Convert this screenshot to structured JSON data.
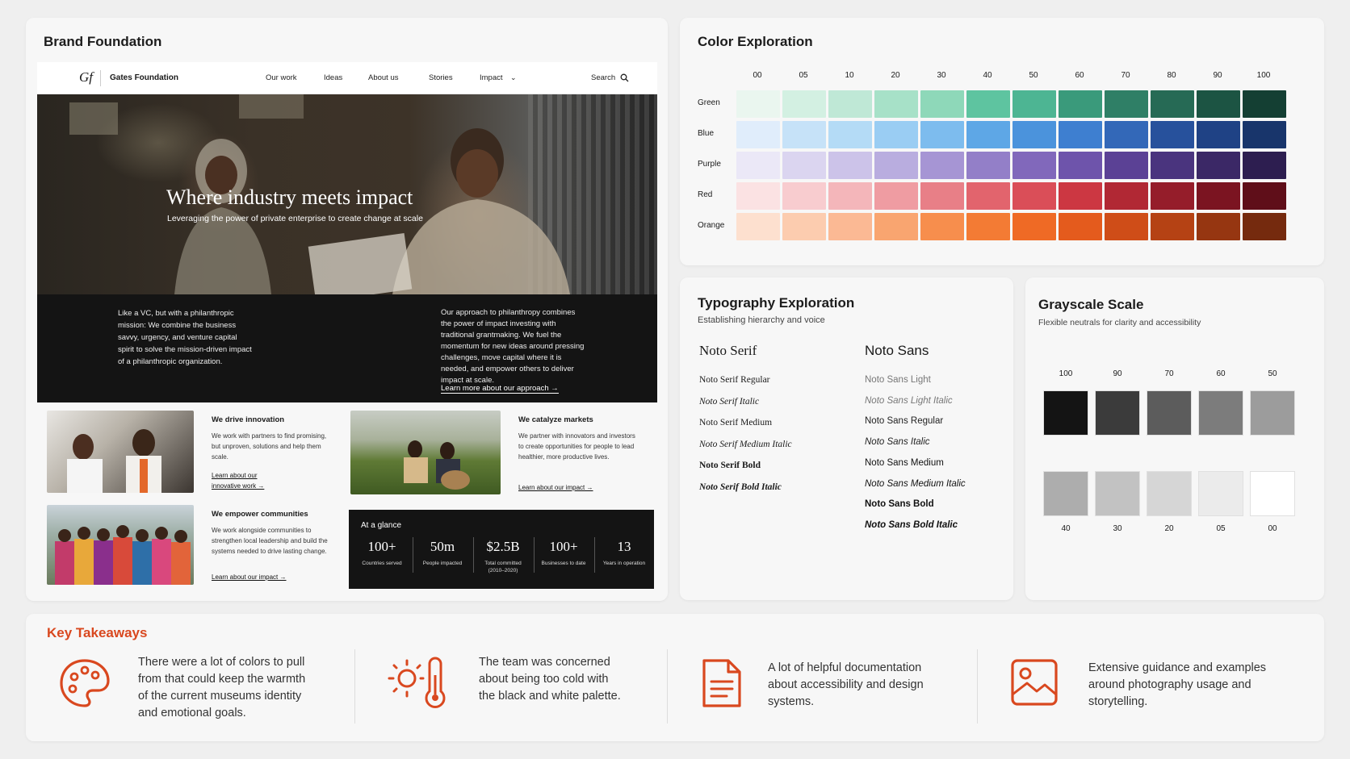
{
  "brand": {
    "title": "Brand Foundation",
    "site": {
      "logo_mark": "Gf",
      "logo_text": "Gates Foundation",
      "nav": [
        "Our work",
        "Ideas",
        "About us",
        "Stories",
        "Impact"
      ],
      "search": "Search",
      "hero_title": "Where industry meets impact",
      "hero_subtitle": "Leveraging the power of private enterprise to create change at scale",
      "intro_left": "Like a VC, but with a philanthropic mission: We combine the business savvy, urgency, and venture capital spirit to solve the mission-driven impact of a philanthropic organization.",
      "intro_right": "Our approach to philanthropy combines the power of impact investing with traditional grantmaking. We fuel the momentum for new ideas around pressing challenges, move capital where it is needed, and empower others to deliver impact at scale.",
      "intro_link": "Learn more about our approach →"
    },
    "features": [
      {
        "title": "We drive innovation",
        "body": "We work with partners to find promising, but unproven, solutions and help them scale.",
        "link": "Learn about our innovative work →"
      },
      {
        "title": "We catalyze markets",
        "body": "We partner with innovators and investors to create opportunities for people to lead healthier, more productive lives.",
        "link": "Learn about our impact →"
      },
      {
        "title": "We empower communities",
        "body": "We work alongside communities to strengthen local leadership and build the systems needed to drive lasting change.",
        "link": "Learn about our impact →"
      }
    ],
    "glance": {
      "title": "At a glance",
      "stats": [
        {
          "value": "100+",
          "label": "Countries served"
        },
        {
          "value": "50m",
          "label": "People impacted"
        },
        {
          "value": "$2.5B",
          "label": "Total committed (2010–2020)"
        },
        {
          "value": "100+",
          "label": "Businesses to date"
        },
        {
          "value": "13",
          "label": "Years in operation"
        }
      ]
    }
  },
  "color_exploration": {
    "title": "Color Exploration",
    "columns": [
      "00",
      "05",
      "10",
      "20",
      "30",
      "40",
      "50",
      "60",
      "70",
      "80",
      "90",
      "100"
    ],
    "rows": [
      {
        "name": "Green",
        "swatches": [
          "#eaf6ef",
          "#d3f0e2",
          "#bfe8d6",
          "#a7e1c8",
          "#8ed8b9",
          "#5ec4a0",
          "#4db593",
          "#3a9a7b",
          "#2f7f66",
          "#266a55",
          "#1c5443",
          "#143f33"
        ]
      },
      {
        "name": "Blue",
        "swatches": [
          "#e0edfb",
          "#c6e2f8",
          "#b4dbf6",
          "#9acdf3",
          "#7dbcee",
          "#5ea7e6",
          "#4b93dc",
          "#3e7fd0",
          "#3368b8",
          "#27519c",
          "#1f4285",
          "#18356b"
        ]
      },
      {
        "name": "Purple",
        "swatches": [
          "#ebe8f7",
          "#dbd5f0",
          "#ccc3e9",
          "#b9addf",
          "#a695d4",
          "#937fc8",
          "#8168bb",
          "#6e54ab",
          "#5b4195",
          "#4a347e",
          "#3b2866",
          "#2d1e50"
        ]
      },
      {
        "name": "Red",
        "swatches": [
          "#fbe2e3",
          "#f8cccf",
          "#f4b6ba",
          "#ef9ca2",
          "#e87f87",
          "#e2646d",
          "#da4e58",
          "#cc3742",
          "#b12834",
          "#951d2a",
          "#7b1421",
          "#5f0e19"
        ]
      },
      {
        "name": "Orange",
        "swatches": [
          "#fde0cf",
          "#fcccaf",
          "#fbb994",
          "#f9a570",
          "#f78e4d",
          "#f37b34",
          "#ef6a25",
          "#e45b1d",
          "#cf4d18",
          "#b54214",
          "#963611",
          "#752a0e"
        ]
      }
    ]
  },
  "typography": {
    "title": "Typography Exploration",
    "subtitle": "Establishing hierarchy and voice",
    "serif_heading": "Noto Serif",
    "sans_heading": "Noto Sans",
    "serif": [
      "Noto Serif Regular",
      "Noto Serif Italic",
      "Noto Serif Medium",
      "Noto Serif Medium Italic",
      "Noto Serif Bold",
      "Noto Serif Bold Italic"
    ],
    "sans": [
      "Noto Sans Light",
      "Noto Sans Light Italic",
      "Noto Sans Regular",
      "Noto Sans Italic",
      "Noto Sans Medium",
      "Noto Sans Medium Italic",
      "Noto Sans Bold",
      "Noto Sans Bold Italic"
    ]
  },
  "grayscale": {
    "title": "Grayscale Scale",
    "subtitle": "Flexible neutrals for clarity and accessibility",
    "top": [
      {
        "label": "100",
        "color": "#141414"
      },
      {
        "label": "90",
        "color": "#3b3b3b"
      },
      {
        "label": "70",
        "color": "#5c5c5c"
      },
      {
        "label": "60",
        "color": "#7c7c7c"
      },
      {
        "label": "50",
        "color": "#9c9c9c"
      }
    ],
    "bottom": [
      {
        "label": "40",
        "color": "#adadad"
      },
      {
        "label": "30",
        "color": "#c2c2c2"
      },
      {
        "label": "20",
        "color": "#d6d6d6"
      },
      {
        "label": "05",
        "color": "#ebebeb"
      },
      {
        "label": "00",
        "color": "#ffffff"
      }
    ]
  },
  "takeaways": {
    "title": "Key Takeaways",
    "accent": "#d9481f",
    "items": [
      {
        "icon": "palette-icon",
        "text": "There were a lot of colors to pull from that could keep the warmth of the current museums identity and emotional goals."
      },
      {
        "icon": "temperature-icon",
        "text": "The team was concerned about being too cold with the black and white palette."
      },
      {
        "icon": "document-icon",
        "text": "A lot of helpful documentation about accessibility and design systems."
      },
      {
        "icon": "image-icon",
        "text": "Extensive guidance and examples around photography usage and storytelling."
      }
    ]
  }
}
